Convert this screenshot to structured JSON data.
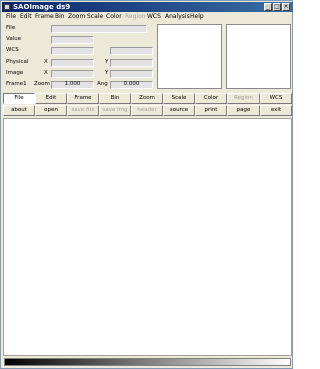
{
  "window": {
    "title": "SAOImage ds9"
  },
  "titlebar_buttons": [
    "_",
    "□",
    "×"
  ],
  "menubar": {
    "items": [
      {
        "label": "File",
        "enabled": true
      },
      {
        "label": "Edit",
        "enabled": true
      },
      {
        "label": "Frame",
        "enabled": true
      },
      {
        "label": "Bin",
        "enabled": true
      },
      {
        "label": "Zoom",
        "enabled": true
      },
      {
        "label": "Scale",
        "enabled": true
      },
      {
        "label": "Color",
        "enabled": true
      },
      {
        "label": "Region",
        "enabled": false
      },
      {
        "label": "WCS",
        "enabled": true
      },
      {
        "label": "Analysis",
        "enabled": true
      },
      {
        "label": "Help",
        "enabled": true
      }
    ]
  },
  "info": {
    "file_label": "File",
    "value_label": "Value",
    "wcs_label": "WCS",
    "physical_label": "Physical",
    "physical_x": "X",
    "physical_y": "Y",
    "image_label": "Image",
    "image_x": "X",
    "image_y": "Y",
    "frame_label": "Frame1",
    "zoom_label": "Zoom",
    "zoom_value": "1.000",
    "angle_label": "Ang",
    "angle_value": "0.000"
  },
  "main_buttons": [
    {
      "label": "File",
      "active": true,
      "enabled": true
    },
    {
      "label": "Edit",
      "active": false,
      "enabled": true
    },
    {
      "label": "Frame",
      "active": false,
      "enabled": true
    },
    {
      "label": "Bin",
      "active": false,
      "enabled": true
    },
    {
      "label": "Zoom",
      "active": false,
      "enabled": true
    },
    {
      "label": "Scale",
      "active": false,
      "enabled": true
    },
    {
      "label": "Color",
      "active": false,
      "enabled": true
    },
    {
      "label": "Region",
      "active": false,
      "enabled": false
    },
    {
      "label": "WCS",
      "active": false,
      "enabled": true
    }
  ],
  "sub_buttons": [
    {
      "label": "about",
      "enabled": true
    },
    {
      "label": "open",
      "enabled": true
    },
    {
      "label": "save fits",
      "enabled": false
    },
    {
      "label": "save img",
      "enabled": false
    },
    {
      "label": "header",
      "enabled": false
    },
    {
      "label": "source",
      "enabled": true
    },
    {
      "label": "print",
      "enabled": true
    },
    {
      "label": "page",
      "enabled": true
    },
    {
      "label": "exit",
      "enabled": true
    }
  ],
  "colors": {
    "titlebar_start": "#0a246a",
    "titlebar_end": "#3a6ea5",
    "window_bg": "#ece9d8",
    "disabled_text": "#a0a0a0"
  }
}
